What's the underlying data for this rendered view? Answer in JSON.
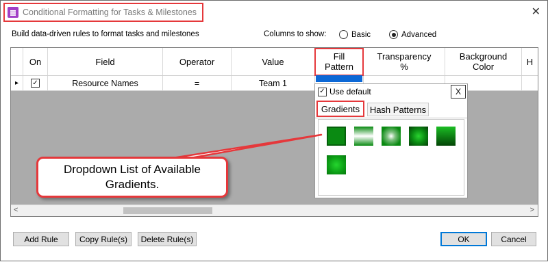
{
  "window": {
    "title": "Conditional Formatting for Tasks & Milestones",
    "close_glyph": "✕"
  },
  "intro": {
    "description": "Build data-driven rules to format tasks and milestones",
    "columns_label": "Columns to show:",
    "options": [
      {
        "label": "Basic",
        "selected": false
      },
      {
        "label": "Advanced",
        "selected": true
      }
    ]
  },
  "table": {
    "headers": [
      "On",
      "Field",
      "Operator",
      "Value",
      "Fill Pattern",
      "Transparency %",
      "Background Color",
      "H"
    ],
    "rows": [
      {
        "on": true,
        "field": "Resource Names",
        "operator": "=",
        "value": "Team 1"
      }
    ],
    "row_arrow": "▸"
  },
  "popup": {
    "use_default_label": "Use default",
    "use_default_checked": true,
    "close_label": "X",
    "tabs": [
      "Gradients",
      "Hash Patterns"
    ],
    "active_tab": "Gradients",
    "gradient_count": 6
  },
  "callout": {
    "text": "Dropdown List of Available Gradients."
  },
  "buttons": {
    "add": "Add Rule",
    "copy": "Copy Rule(s)",
    "delete": "Delete Rule(s)",
    "ok": "OK",
    "cancel": "Cancel"
  },
  "colors": {
    "accent_red": "#e5383b",
    "selection_blue": "#0c68d6",
    "gradient_green": "#0a8a12"
  },
  "icons": [
    "app-icon",
    "close-icon",
    "row-arrow-icon",
    "scroll-left-icon",
    "scroll-right-icon"
  ]
}
